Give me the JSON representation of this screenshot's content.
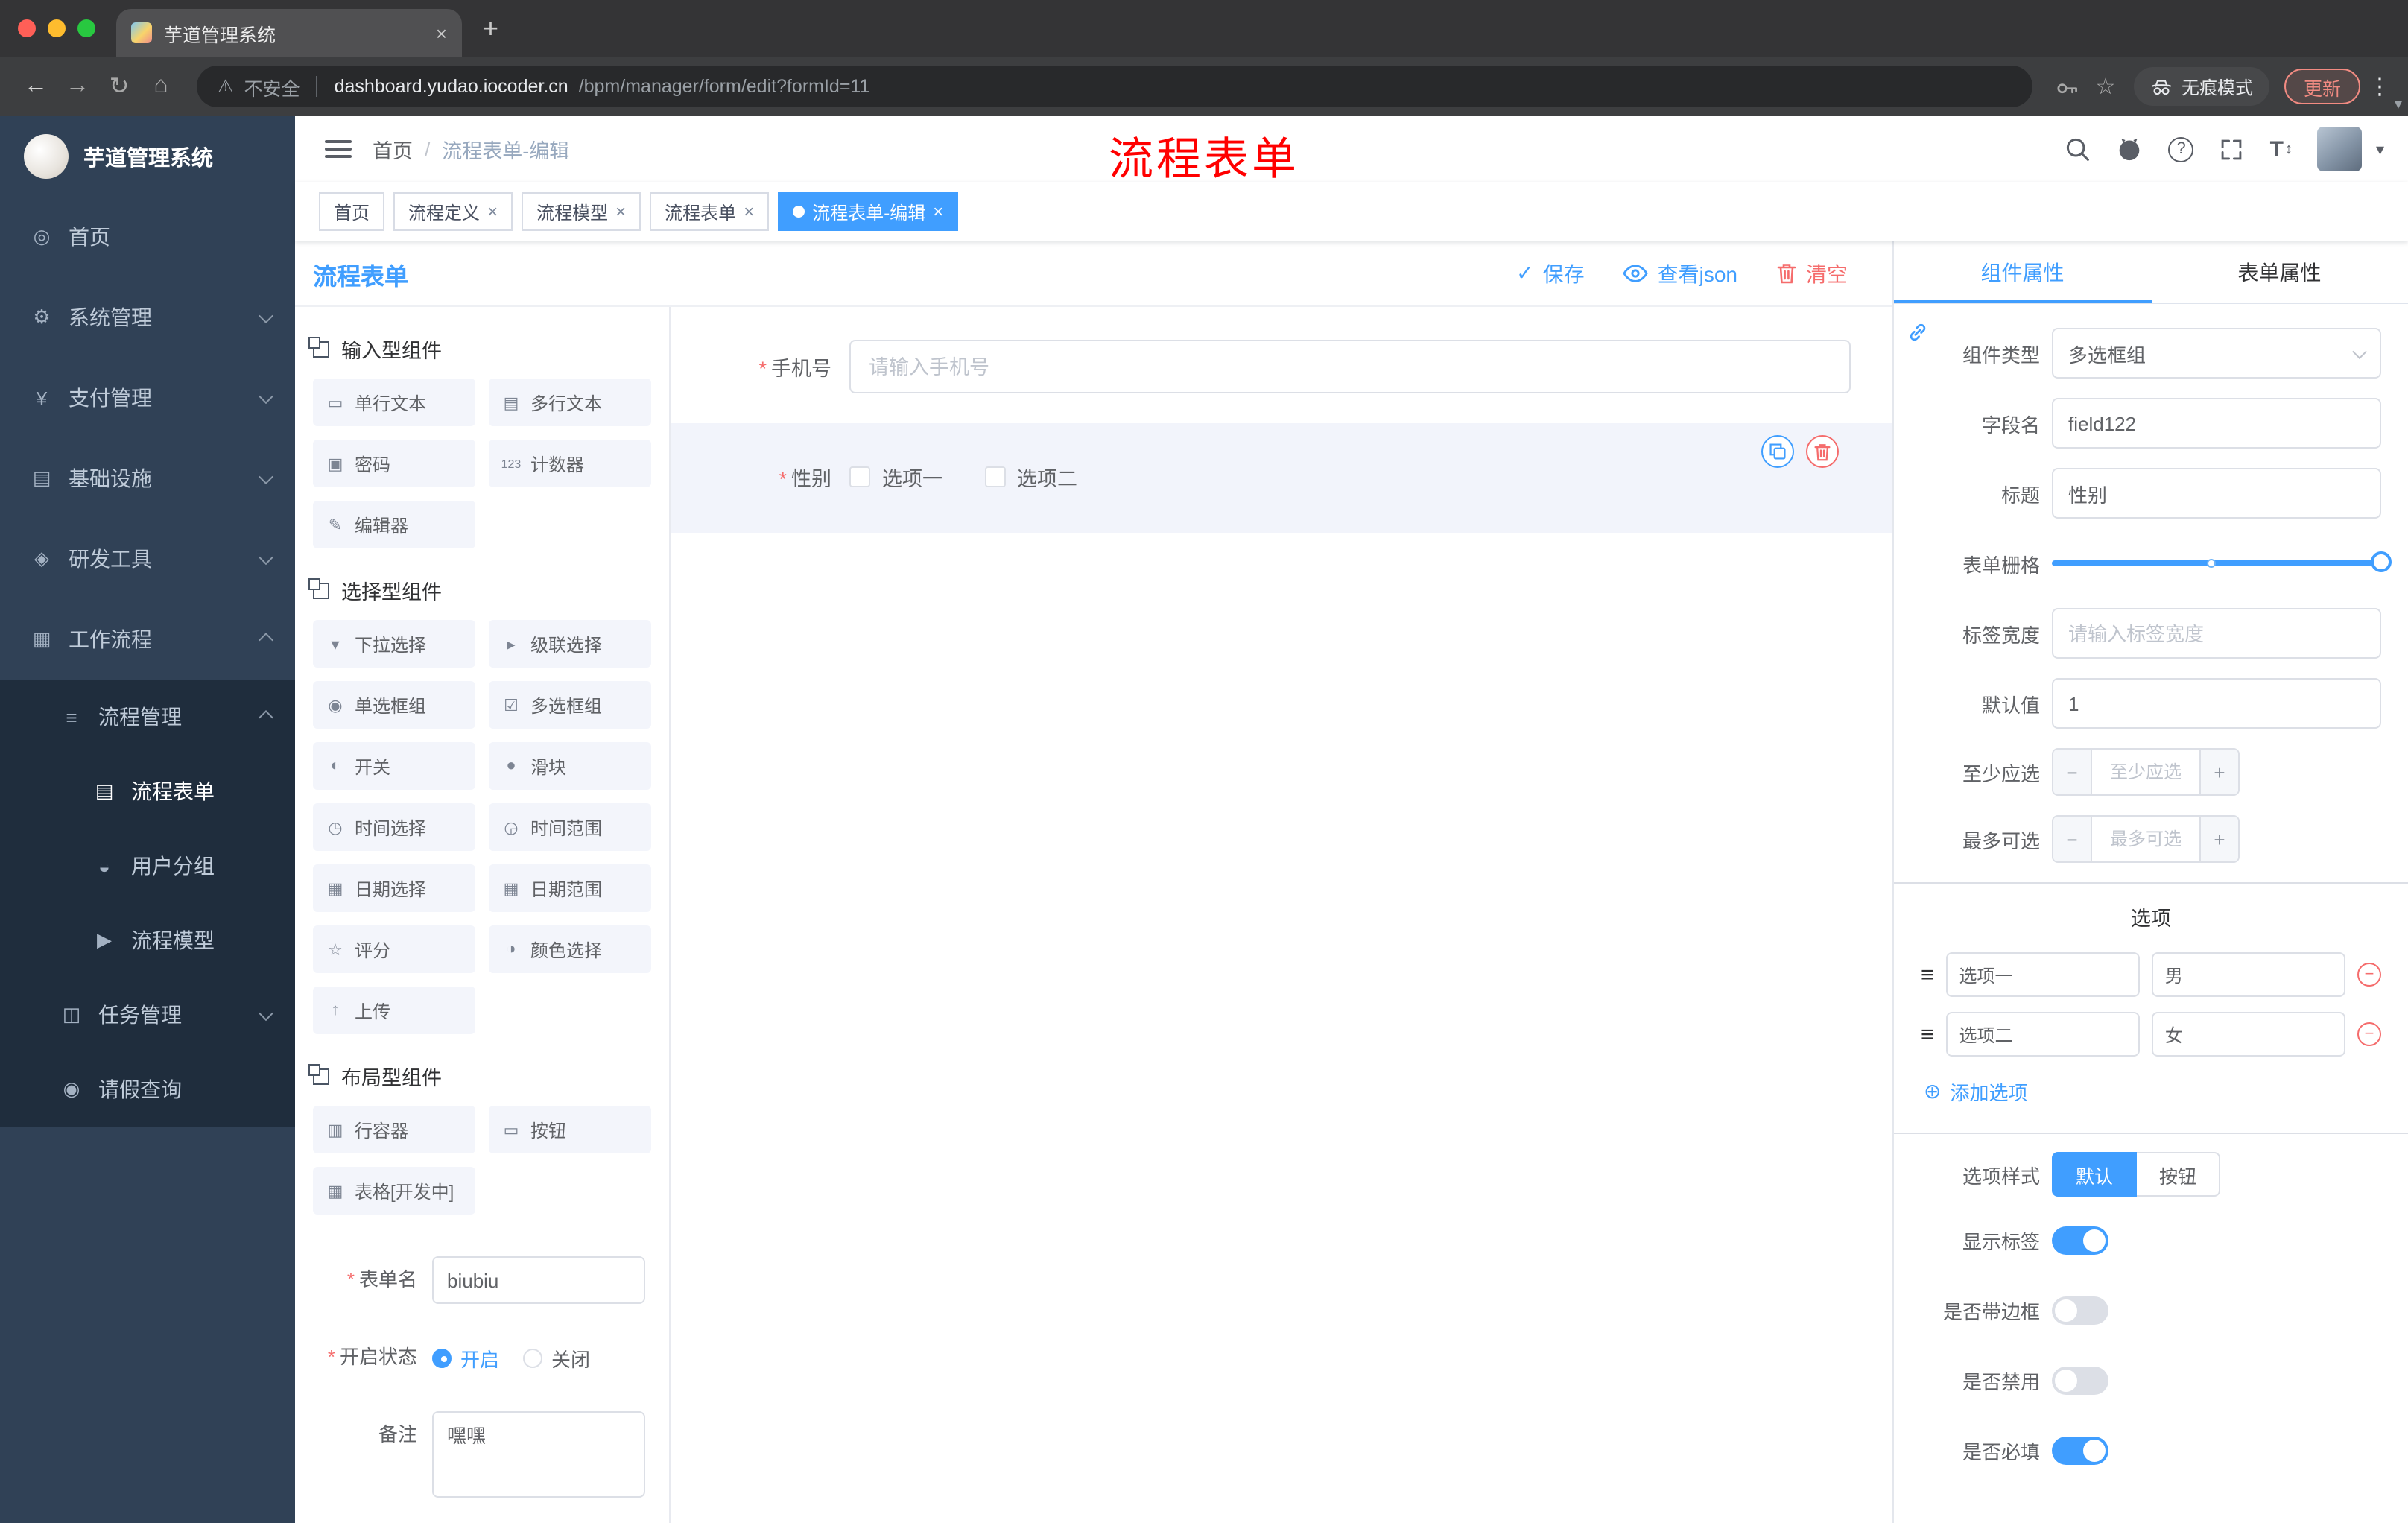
{
  "glyphs": {
    "close": "×",
    "plus": "+",
    "check": "✓",
    "asterisk": "*",
    "slash": "/",
    "menu_dots": "⋮",
    "star": "☆",
    "warning": "⚠",
    "caret": "▾",
    "question": "?",
    "font_t": "T",
    "updown": "↕",
    "minus": "−",
    "add": "⊕",
    "back": "←",
    "forward": "→",
    "reload": "↻",
    "home": "⌂",
    "handle": "≡",
    "dot": "●"
  },
  "chrome": {
    "tab_title": "芋道管理系统",
    "security": "不安全",
    "url_host": "dashboard.yudao.iocoder.cn",
    "url_path": "/bpm/manager/form/edit?formId=11",
    "incognito": "无痕模式",
    "update": "更新"
  },
  "sidebar": {
    "logo_title": "芋道管理系统",
    "menu": [
      {
        "label": "首页",
        "glyph": "◎"
      },
      {
        "label": "系统管理",
        "glyph": "⚙"
      },
      {
        "label": "支付管理",
        "glyph": "¥"
      },
      {
        "label": "基础设施",
        "glyph": "▤"
      },
      {
        "label": "研发工具",
        "glyph": "◈"
      },
      {
        "label": "工作流程",
        "glyph": "▦"
      },
      {
        "label": "流程管理",
        "glyph": "≡"
      },
      {
        "label": "流程表单",
        "glyph": "▤"
      },
      {
        "label": "用户分组",
        "glyph": "◒"
      },
      {
        "label": "流程模型",
        "glyph": "▶"
      },
      {
        "label": "任务管理",
        "glyph": "◫"
      },
      {
        "label": "请假查询",
        "glyph": "◉"
      }
    ]
  },
  "header": {
    "breadcrumb_home": "首页",
    "breadcrumb_current": "流程表单-编辑",
    "annotation": "流程表单"
  },
  "tags": [
    {
      "label": "首页"
    },
    {
      "label": "流程定义"
    },
    {
      "label": "流程模型"
    },
    {
      "label": "流程表单"
    },
    {
      "label": "流程表单-编辑"
    }
  ],
  "designer": {
    "title": "流程表单",
    "save": "保存",
    "view_json": "查看json",
    "clear": "清空",
    "groups": [
      {
        "title": "输入型组件",
        "items": [
          {
            "label": "单行文本",
            "glyph": "▭"
          },
          {
            "label": "多行文本",
            "glyph": "▤"
          },
          {
            "label": "密码",
            "glyph": "▣"
          },
          {
            "label": "计数器",
            "glyph": "123"
          },
          {
            "label": "编辑器",
            "glyph": "✎"
          }
        ]
      },
      {
        "title": "选择型组件",
        "items": [
          {
            "label": "下拉选择",
            "glyph": "▾"
          },
          {
            "label": "级联选择",
            "glyph": "▸"
          },
          {
            "label": "单选框组",
            "glyph": "◉"
          },
          {
            "label": "多选框组",
            "glyph": "☑"
          },
          {
            "label": "开关",
            "glyph": "◐"
          },
          {
            "label": "滑块",
            "glyph": "●"
          },
          {
            "label": "时间选择",
            "glyph": "◷"
          },
          {
            "label": "时间范围",
            "glyph": "◶"
          },
          {
            "label": "日期选择",
            "glyph": "▦"
          },
          {
            "label": "日期范围",
            "glyph": "▦"
          },
          {
            "label": "评分",
            "glyph": "☆"
          },
          {
            "label": "颜色选择",
            "glyph": "◑"
          },
          {
            "label": "上传",
            "glyph": "↑"
          }
        ]
      },
      {
        "title": "布局型组件",
        "items": [
          {
            "label": "行容器",
            "glyph": "▥"
          },
          {
            "label": "按钮",
            "glyph": "▭"
          },
          {
            "label": "表格[开发中]",
            "glyph": "▦"
          }
        ]
      }
    ],
    "meta": {
      "form_name_label": "表单名",
      "form_name_value": "biubiu",
      "status_label": "开启状态",
      "status_on": "开启",
      "status_off": "关闭",
      "remark_label": "备注",
      "remark_value": "嘿嘿"
    },
    "canvas": {
      "phone_label": "手机号",
      "phone_placeholder": "请输入手机号",
      "gender_label": "性别",
      "gender_opt1": "选项一",
      "gender_opt2": "选项二"
    }
  },
  "panel": {
    "tab_component": "组件属性",
    "tab_form": "表单属性",
    "component_type_label": "组件类型",
    "component_type_value": "多选框组",
    "field_name_label": "字段名",
    "field_name_value": "field122",
    "title_label": "标题",
    "title_value": "性别",
    "grid_label": "表单栅格",
    "label_width_label": "标签宽度",
    "label_width_placeholder": "请输入标签宽度",
    "default_label": "默认值",
    "default_value": "1",
    "min_label": "至少应选",
    "min_placeholder": "至少应选",
    "max_label": "最多可选",
    "max_placeholder": "最多可选",
    "options_title": "选项",
    "options": [
      {
        "label": "选项一",
        "value": "男"
      },
      {
        "label": "选项二",
        "value": "女"
      }
    ],
    "add_option": "添加选项",
    "style_label": "选项样式",
    "style_default": "默认",
    "style_button": "按钮",
    "switch_show_label": "显示标签",
    "switch_border": "是否带边框",
    "switch_disabled": "是否禁用",
    "switch_required": "是否必填",
    "accent_color": "#409eff",
    "danger_color": "#f56c6c"
  }
}
